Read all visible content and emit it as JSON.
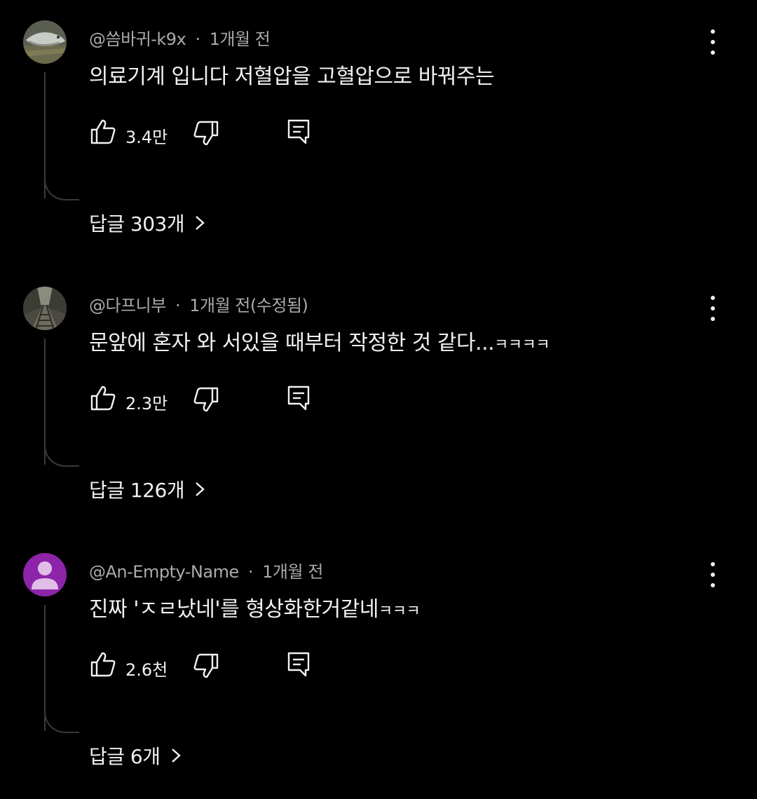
{
  "colors": {
    "background": "#000000",
    "text_primary": "#f1f1f1",
    "text_secondary": "#aaaaaa",
    "thread_line": "#3a3a3a",
    "default_avatar": "#8e24aa"
  },
  "comments": [
    {
      "author": "@씀바귀-k9x",
      "separator": "·",
      "time": "1개월 전",
      "avatar_icon": "fish-photo-avatar",
      "text": "의료기계 입니다 저혈압을  고혈압으로 바꿔주는",
      "text_suffix": "",
      "likes": "3.4만",
      "replies_label": "답글 303개"
    },
    {
      "author": "@다프니부",
      "separator": "·",
      "time": "1개월 전(수정됨)",
      "avatar_icon": "railroad-photo-avatar",
      "text": "문앞에 혼자 와 서있을 때부터 작정한 것 같다...",
      "text_suffix": "ㅋㅋㅋㅋ",
      "likes": "2.3만",
      "replies_label": "답글 126개"
    },
    {
      "author": "@An-Empty-Name",
      "separator": "·",
      "time": "1개월 전",
      "avatar_icon": "default-person-avatar",
      "text": "진짜 'ㅈㄹ났네'를 형상화한거같네",
      "text_suffix": "ㅋㅋㅋ",
      "likes": "2.6천",
      "replies_label": "답글 6개"
    }
  ]
}
